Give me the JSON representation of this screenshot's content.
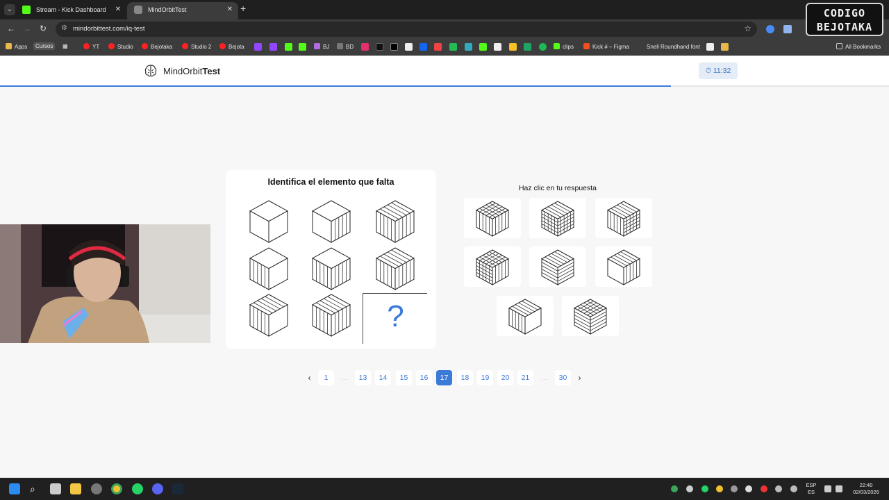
{
  "browser": {
    "tabs": [
      {
        "title": "Stream - Kick Dashboard"
      },
      {
        "title": "MindOrbitTest"
      }
    ],
    "url": "mindorbittest.com/iq-test",
    "bookmarks": [
      "Apps",
      "Cursos",
      "YT",
      "Studio",
      "Bejotaka",
      "Studio 2",
      "Bejota",
      "BJ",
      "BD",
      "clips",
      "Kick # – Figma",
      "Snell Roundhand font",
      "All Bookmarks"
    ],
    "overlay_logo": [
      "CODIGO",
      "BEJOTAKA"
    ]
  },
  "site": {
    "brand_regular": "MindOrbit",
    "brand_bold": "Test",
    "timer": "11:32",
    "progress": 0.755
  },
  "question": {
    "title": "Identifica el elemento que falta",
    "missing_symbol": "?",
    "grid_cubes": [
      {
        "top": "plain",
        "front": "plain",
        "side": "plain"
      },
      {
        "top": "plain",
        "front": "plain",
        "side": "vertical"
      },
      {
        "top": "vertical",
        "front": "vertical",
        "side": "vertical"
      },
      {
        "top": "plain",
        "front": "vertical",
        "side": "plain"
      },
      {
        "top": "plain",
        "front": "vertical",
        "side": "vertical"
      },
      {
        "top": "vertical",
        "front": "vertical",
        "side": "vertical"
      },
      {
        "top": "vertical",
        "front": "vertical",
        "side": "plain"
      },
      {
        "top": "vertical",
        "front": "vertical",
        "side": "vertical"
      }
    ]
  },
  "answers": {
    "title": "Haz clic en tu respuesta",
    "options": [
      {
        "top": "grid",
        "front": "vertical",
        "side": "vertical"
      },
      {
        "top": "vertical",
        "front": "grid",
        "side": "grid"
      },
      {
        "top": "vertical",
        "front": "vertical",
        "side": "grid"
      },
      {
        "top": "grid",
        "front": "grid",
        "side": "vertical"
      },
      {
        "top": "vertical",
        "front": "horizontal",
        "side": "horizontal"
      },
      {
        "top": "vertical",
        "front": "plain",
        "side": "vertical"
      },
      {
        "top": "vertical",
        "front": "vertical",
        "side": "plain"
      },
      {
        "top": "grid",
        "front": "horizontal",
        "side": "horizontal"
      }
    ]
  },
  "pagination": {
    "prev": "‹",
    "next": "›",
    "ellipsis": "...",
    "pages": [
      "1",
      "13",
      "14",
      "15",
      "16",
      "17",
      "18",
      "19",
      "20",
      "21",
      "30"
    ],
    "current": "17"
  },
  "taskbar": {
    "lang": "ESP",
    "lang_sub": "ES",
    "time": "22:40",
    "date": "02/03/2026"
  },
  "colors": {
    "accent": "#3b7ad9",
    "kick_green": "#53fc18"
  }
}
